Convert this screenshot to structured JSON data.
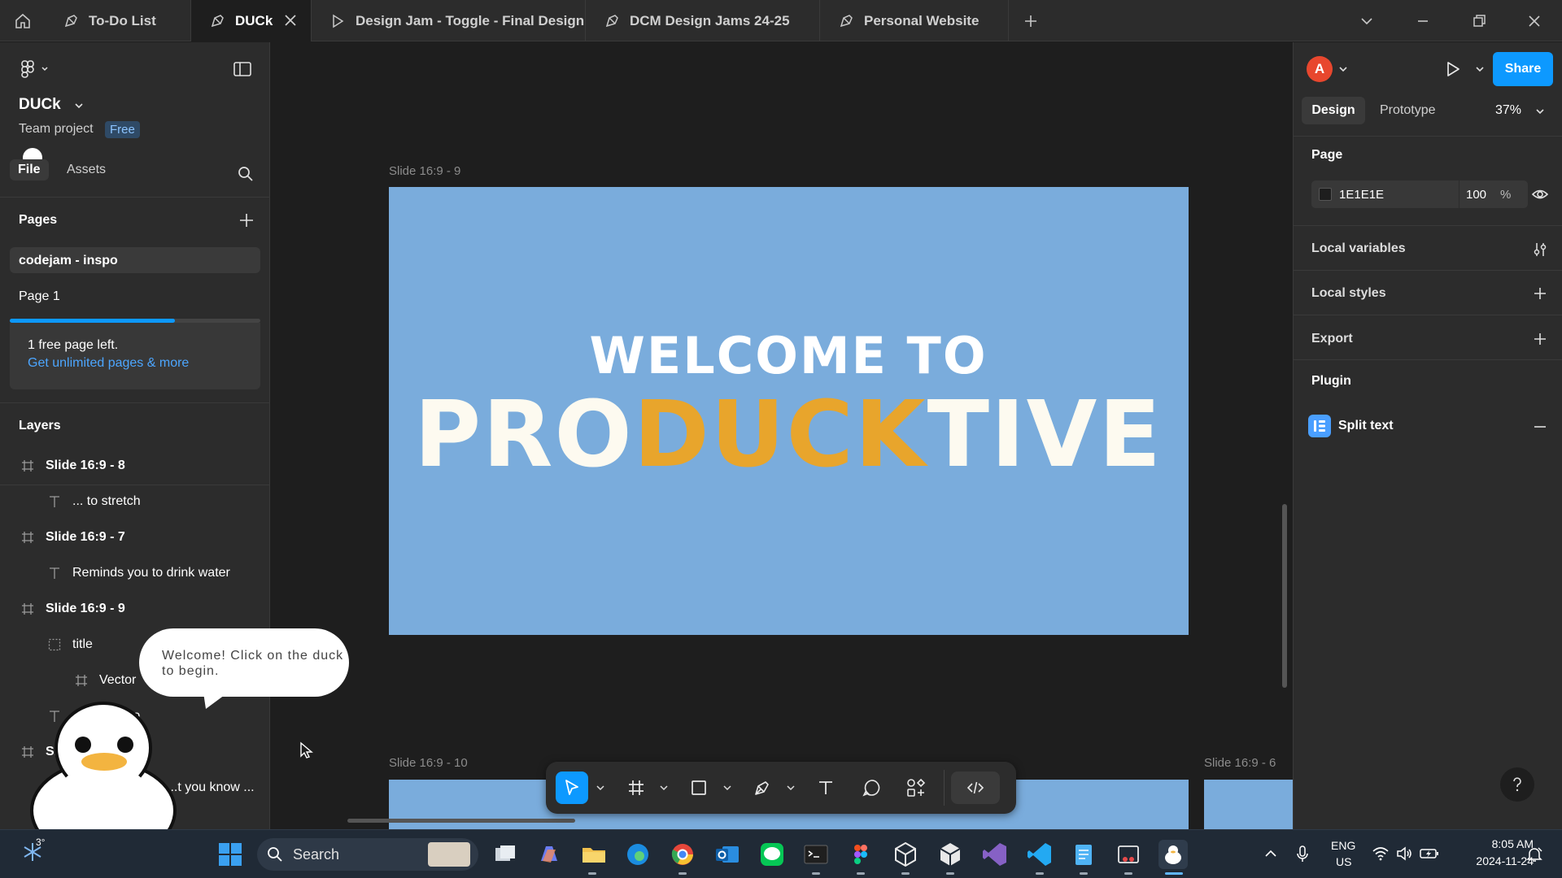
{
  "tabs": [
    {
      "label": "To-Do List"
    },
    {
      "label": "DUCk"
    },
    {
      "label": "Design Jam - Toggle - Final Design"
    },
    {
      "label": "DCM Design Jams 24-25"
    },
    {
      "label": "Personal Website"
    }
  ],
  "file": {
    "name": "DUCk",
    "project": "Team project",
    "plan_badge": "Free"
  },
  "left_tabs": {
    "file": "File",
    "assets": "Assets"
  },
  "pages": {
    "title": "Pages",
    "items": [
      "codejam - inspo",
      "Page 1"
    ],
    "upsell_text": "1 free page left.",
    "upsell_link": "Get unlimited pages & more",
    "usage_fraction": 0.66
  },
  "layers": {
    "title": "Layers",
    "items": [
      {
        "label": "Slide 16:9 - 8",
        "kind": "frame"
      },
      {
        "label": "... to stretch",
        "kind": "text"
      },
      {
        "label": "Slide 16:9 - 7",
        "kind": "frame"
      },
      {
        "label": "Reminds you to drink water",
        "kind": "text"
      },
      {
        "label": "Slide 16:9 - 9",
        "kind": "frame"
      },
      {
        "label": "title",
        "kind": "group"
      },
      {
        "label": "Vector",
        "kind": "vector"
      },
      {
        "label": "...o",
        "kind": "text"
      },
      {
        "label": "Sl...",
        "kind": "frame"
      },
      {
        "label": "...t you know ...",
        "kind": "text"
      }
    ]
  },
  "canvas": {
    "frames": [
      {
        "label": "Slide 16:9 - 9"
      },
      {
        "label": "Slide 16:9 - 10"
      },
      {
        "label": "Slide 16:9 - 6"
      }
    ],
    "slide_heading": "WELCOME TO",
    "slide_title_parts": [
      "PRO",
      "DUCK",
      "TIVE"
    ],
    "slide_color": "#7aacdc",
    "accent_color": "#e8a52c"
  },
  "right": {
    "avatar_letter": "A",
    "share_label": "Share",
    "tabs": {
      "design": "Design",
      "prototype": "Prototype"
    },
    "zoom": "37%",
    "page_section": "Page",
    "page_color": "1E1E1E",
    "page_opacity": "100",
    "percent_sign": "%",
    "local_variables": "Local variables",
    "local_styles": "Local styles",
    "export": "Export",
    "plugin": "Plugin",
    "plugin_item": "Split text"
  },
  "duck": {
    "bubble_text": "Welcome! Click on the duck to begin."
  },
  "taskbar": {
    "search_placeholder": "Search",
    "weather": "3°",
    "lang_top": "ENG",
    "lang_bottom": "US",
    "time": "8:05 AM",
    "date": "2024-11-24"
  },
  "colors": {
    "accent_blue": "#0d99ff",
    "brand_blue": "#4a9fff"
  }
}
